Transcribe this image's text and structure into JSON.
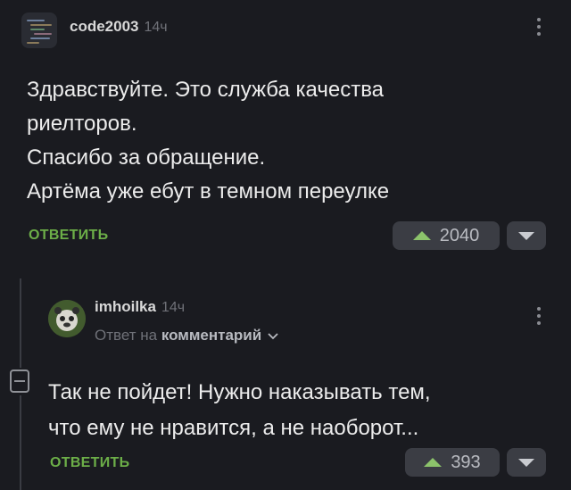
{
  "comment1": {
    "author": "code2003",
    "time": "14ч",
    "lines": [
      "Здравствуйте. Это служба качества",
      "риелторов.",
      "Спасибо за обращение.",
      "Артёма уже ебут в темном переулке"
    ],
    "reply_label": "ОТВЕТИТЬ",
    "rating": "2040"
  },
  "comment2": {
    "author": "imhoilka",
    "time": "14ч",
    "reply_to_prefix": "Ответ на",
    "reply_to_link": "комментарий",
    "lines": [
      "Так не пойдет! Нужно наказывать тем,",
      "что ему не нравится, а не наоборот..."
    ],
    "reply_label": "ОТВЕТИТЬ",
    "rating": "393"
  },
  "colors": {
    "background": "#1a1b20",
    "accent_green": "#6cae48",
    "rating_bg": "#3b3d44"
  },
  "icons": [
    "kebab-menu-icon",
    "upvote-icon",
    "downvote-icon",
    "collapse-thread-icon",
    "chevron-down-icon"
  ]
}
